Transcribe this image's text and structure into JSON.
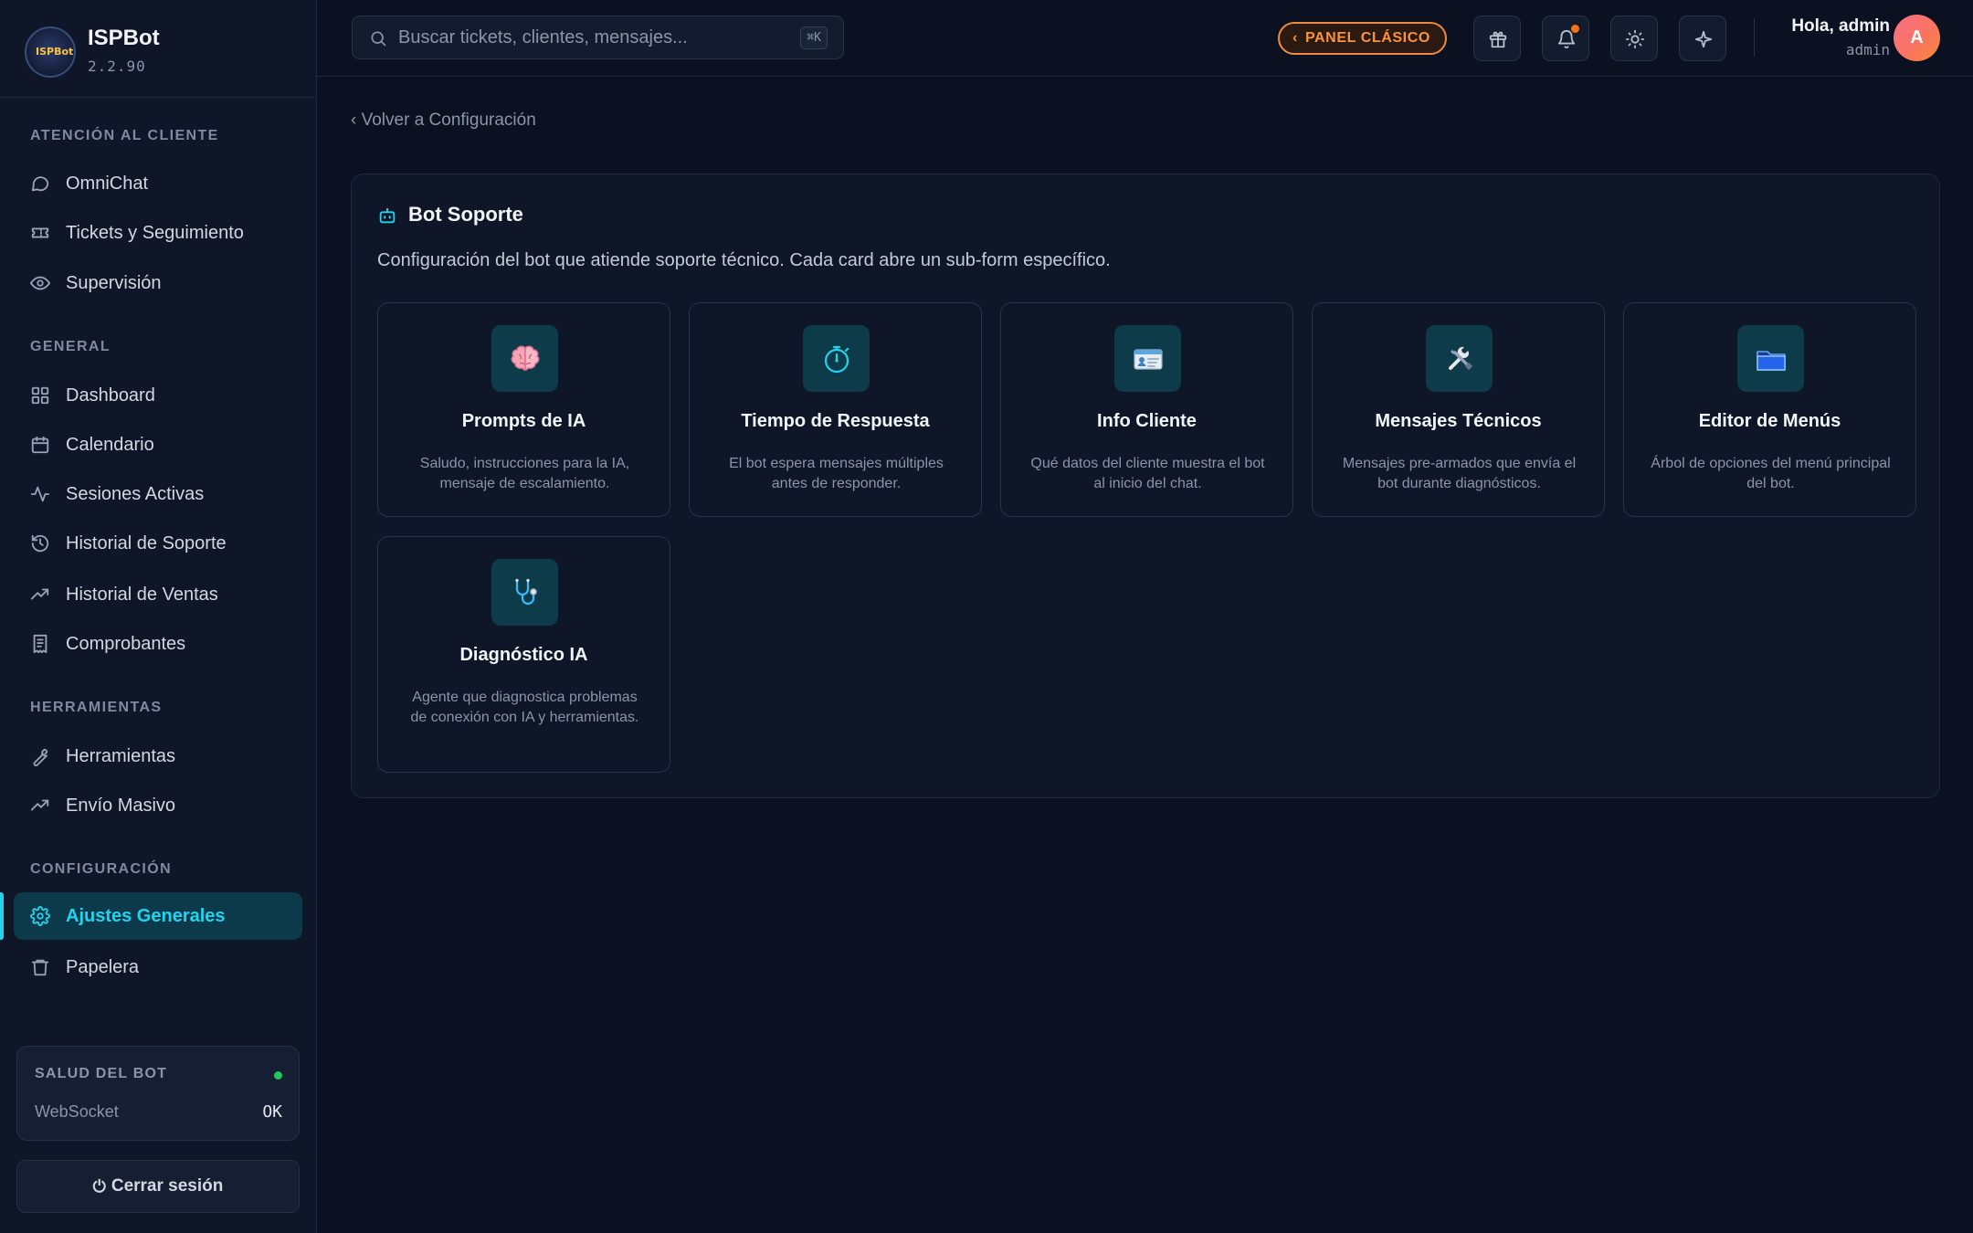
{
  "brand": {
    "name": "ISPBot",
    "version": "2.2.90",
    "logo_text": "ISPBot"
  },
  "sidebar": {
    "sections": [
      {
        "title": "ATENCIÓN AL CLIENTE",
        "items": [
          {
            "label": "OmniChat",
            "icon": "chat-bubble-icon"
          },
          {
            "label": "Tickets y Seguimiento",
            "icon": "ticket-icon"
          },
          {
            "label": "Supervisión",
            "icon": "eye-icon"
          }
        ]
      },
      {
        "title": "GENERAL",
        "items": [
          {
            "label": "Dashboard",
            "icon": "grid-icon"
          },
          {
            "label": "Calendario",
            "icon": "calendar-icon"
          },
          {
            "label": "Sesiones Activas",
            "icon": "activity-icon"
          },
          {
            "label": "Historial de Soporte",
            "icon": "history-icon"
          },
          {
            "label": "Historial de Ventas",
            "icon": "trending-up-icon"
          },
          {
            "label": "Comprobantes",
            "icon": "receipt-icon"
          }
        ]
      },
      {
        "title": "HERRAMIENTAS",
        "items": [
          {
            "label": "Herramientas",
            "icon": "wrench-icon"
          },
          {
            "label": "Envío Masivo",
            "icon": "trending-up-icon"
          }
        ]
      },
      {
        "title": "CONFIGURACIÓN",
        "items": [
          {
            "label": "Ajustes Generales",
            "icon": "gear-icon",
            "active": true
          },
          {
            "label": "Papelera",
            "icon": "trash-icon"
          }
        ]
      }
    ],
    "health": {
      "title": "SALUD DEL BOT",
      "key": "WebSocket",
      "value": "OK",
      "status_color": "#22c55e"
    },
    "logout_label": "Cerrar sesión"
  },
  "topbar": {
    "search_placeholder": "Buscar tickets, clientes, mensajes...",
    "search_shortcut": "⌘K",
    "classic_label": "PANEL CLÁSICO",
    "greeting": "Hola, admin",
    "username": "admin",
    "avatar_initial": "A",
    "icons": [
      "gift-icon",
      "bell-icon",
      "sun-icon",
      "sparkle-icon"
    ]
  },
  "main": {
    "back_label": "‹ Volver a Configuración",
    "panel": {
      "title": "Bot Soporte",
      "description": "Configuración del bot que atiende soporte técnico. Cada card abre un sub-form específico.",
      "cards": [
        {
          "title": "Prompts de IA",
          "desc": "Saludo, instrucciones para la IA, mensaje de escalamiento.",
          "icon": "brain-icon"
        },
        {
          "title": "Tiempo de Respuesta",
          "desc": "El bot espera mensajes múltiples antes de responder.",
          "icon": "stopwatch-icon"
        },
        {
          "title": "Info Cliente",
          "desc": "Qué datos del cliente muestra el bot al inicio del chat.",
          "icon": "id-card-icon"
        },
        {
          "title": "Mensajes Técnicos",
          "desc": "Mensajes pre-armados que envía el bot durante diagnósticos.",
          "icon": "tools-icon"
        },
        {
          "title": "Editor de Menús",
          "desc": "Árbol de opciones del menú principal del bot.",
          "icon": "folder-icon"
        },
        {
          "title": "Diagnóstico IA",
          "desc": "Agente que diagnostica problemas de conexión con IA y herramientas.",
          "icon": "stethoscope-icon"
        }
      ]
    }
  },
  "colors": {
    "accent": "#22d3ee",
    "classic": "#fb923c",
    "background": "#0b1120"
  }
}
